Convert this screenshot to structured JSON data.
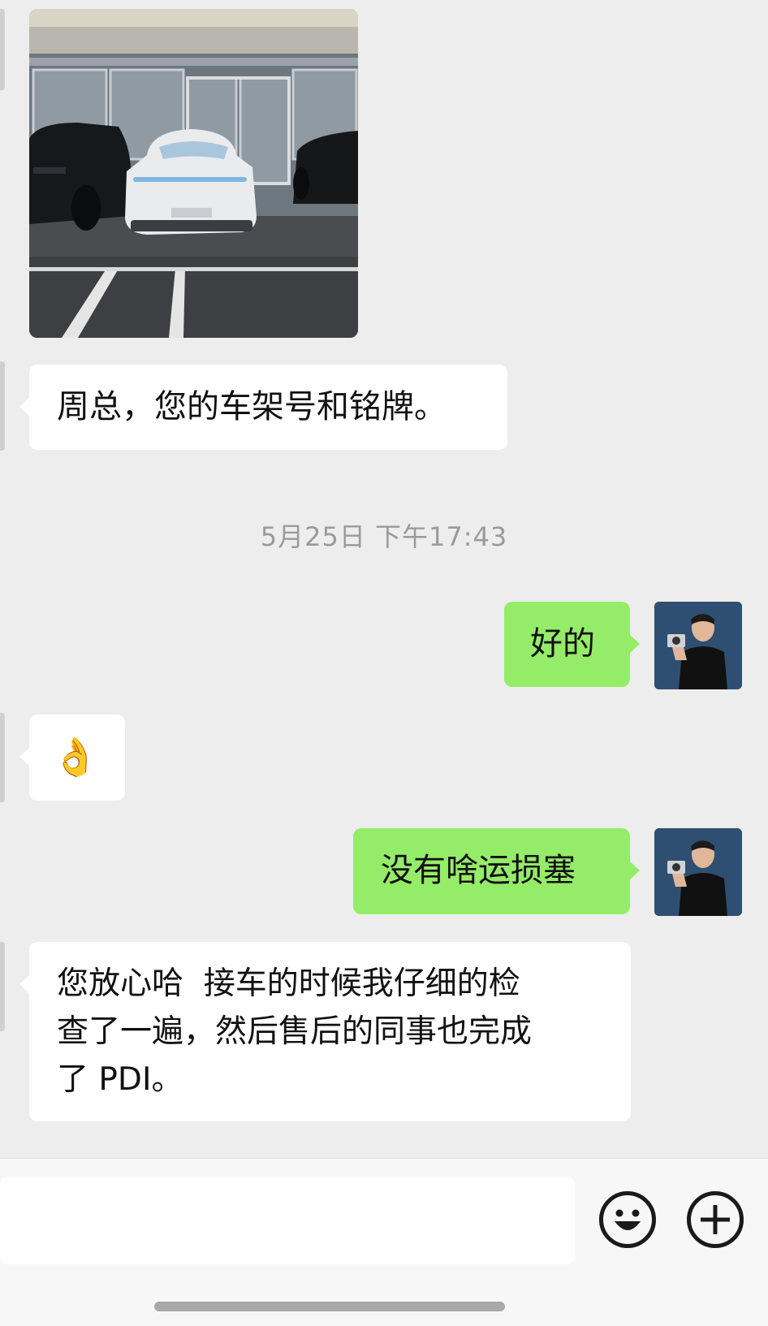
{
  "messages": {
    "m1_text": "周总，您的车架号和铭牌。",
    "timestamp": "5月25日 下午17:43",
    "m2_text": "好的",
    "m3_emoji": "👌",
    "m4_text": "没有啥运损塞",
    "m5_line1": "您放心哈  接车的时候我仔细的检",
    "m5_line2": "查了一遍，然后售后的同事也完成",
    "m5_line3": "了 PDI。"
  },
  "icons": {
    "emoji_button": "smiley-face-icon",
    "add_button": "plus-icon",
    "hand_emoji": "ok-hand-icon"
  },
  "colors": {
    "background": "#ededed",
    "received_bubble": "#ffffff",
    "sent_bubble": "#95ec69",
    "timestamp_text": "#9a9a9a"
  }
}
